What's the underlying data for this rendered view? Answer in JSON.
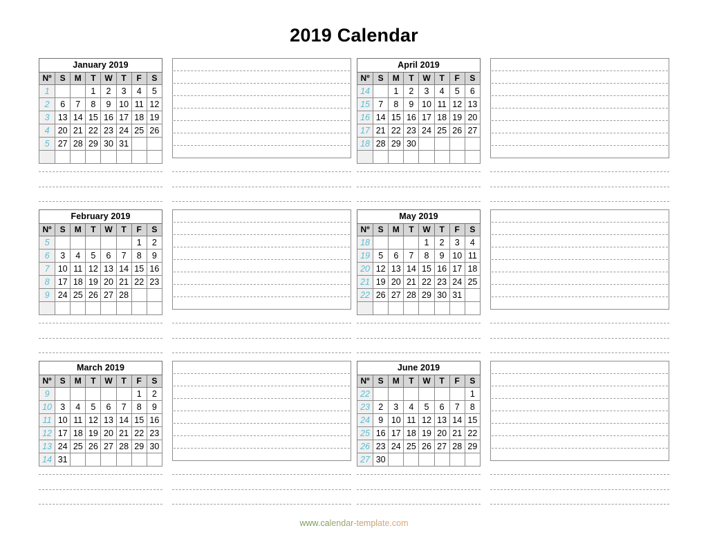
{
  "page": {
    "title": "2019 Calendar",
    "footer_url": "www.calendar-template.com",
    "footer_parts": [
      "www.ca",
      "lendar",
      "-templ",
      "ate.com"
    ]
  },
  "colors": {
    "week_number": "#5bbcd6",
    "header_row_bg": "#d6d6d6",
    "week_col_bg": "#f0f0f0",
    "table_border": "#8a8a8a",
    "dashed_line": "#9a9a9a",
    "footer_green": "#7ba05b",
    "footer_orange": "#d8a878"
  },
  "labels": {
    "week_col_header": "Nº",
    "day_headers": [
      "S",
      "M",
      "T",
      "W",
      "T",
      "F",
      "S"
    ]
  },
  "months": [
    {
      "name": "January 2019",
      "weeks": [
        {
          "no": "1",
          "days": [
            "",
            "",
            "1",
            "2",
            "3",
            "4",
            "5"
          ]
        },
        {
          "no": "2",
          "days": [
            "6",
            "7",
            "8",
            "9",
            "10",
            "11",
            "12"
          ]
        },
        {
          "no": "3",
          "days": [
            "13",
            "14",
            "15",
            "16",
            "17",
            "18",
            "19"
          ]
        },
        {
          "no": "4",
          "days": [
            "20",
            "21",
            "22",
            "23",
            "24",
            "25",
            "26"
          ]
        },
        {
          "no": "5",
          "days": [
            "27",
            "28",
            "29",
            "30",
            "31",
            "",
            ""
          ]
        },
        {
          "no": "",
          "days": [
            "",
            "",
            "",
            "",
            "",
            "",
            ""
          ]
        }
      ]
    },
    {
      "name": "February 2019",
      "weeks": [
        {
          "no": "5",
          "days": [
            "",
            "",
            "",
            "",
            "",
            "1",
            "2"
          ]
        },
        {
          "no": "6",
          "days": [
            "3",
            "4",
            "5",
            "6",
            "7",
            "8",
            "9"
          ]
        },
        {
          "no": "7",
          "days": [
            "10",
            "11",
            "12",
            "13",
            "14",
            "15",
            "16"
          ]
        },
        {
          "no": "8",
          "days": [
            "17",
            "18",
            "19",
            "20",
            "21",
            "22",
            "23"
          ]
        },
        {
          "no": "9",
          "days": [
            "24",
            "25",
            "26",
            "27",
            "28",
            "",
            ""
          ]
        },
        {
          "no": "",
          "days": [
            "",
            "",
            "",
            "",
            "",
            "",
            ""
          ]
        }
      ]
    },
    {
      "name": "March 2019",
      "weeks": [
        {
          "no": "9",
          "days": [
            "",
            "",
            "",
            "",
            "",
            "1",
            "2"
          ]
        },
        {
          "no": "10",
          "days": [
            "3",
            "4",
            "5",
            "6",
            "7",
            "8",
            "9"
          ]
        },
        {
          "no": "11",
          "days": [
            "10",
            "11",
            "12",
            "13",
            "14",
            "15",
            "16"
          ]
        },
        {
          "no": "12",
          "days": [
            "17",
            "18",
            "19",
            "20",
            "21",
            "22",
            "23"
          ]
        },
        {
          "no": "13",
          "days": [
            "24",
            "25",
            "26",
            "27",
            "28",
            "29",
            "30"
          ]
        },
        {
          "no": "14",
          "days": [
            "31",
            "",
            "",
            "",
            "",
            "",
            ""
          ]
        }
      ]
    },
    {
      "name": "April 2019",
      "weeks": [
        {
          "no": "14",
          "days": [
            "",
            "1",
            "2",
            "3",
            "4",
            "5",
            "6"
          ]
        },
        {
          "no": "15",
          "days": [
            "7",
            "8",
            "9",
            "10",
            "11",
            "12",
            "13"
          ]
        },
        {
          "no": "16",
          "days": [
            "14",
            "15",
            "16",
            "17",
            "18",
            "19",
            "20"
          ]
        },
        {
          "no": "17",
          "days": [
            "21",
            "22",
            "23",
            "24",
            "25",
            "26",
            "27"
          ]
        },
        {
          "no": "18",
          "days": [
            "28",
            "29",
            "30",
            "",
            "",
            "",
            ""
          ]
        },
        {
          "no": "",
          "days": [
            "",
            "",
            "",
            "",
            "",
            "",
            ""
          ]
        }
      ]
    },
    {
      "name": "May 2019",
      "weeks": [
        {
          "no": "18",
          "days": [
            "",
            "",
            "",
            "1",
            "2",
            "3",
            "4"
          ]
        },
        {
          "no": "19",
          "days": [
            "5",
            "6",
            "7",
            "8",
            "9",
            "10",
            "11"
          ]
        },
        {
          "no": "20",
          "days": [
            "12",
            "13",
            "14",
            "15",
            "16",
            "17",
            "18"
          ]
        },
        {
          "no": "21",
          "days": [
            "19",
            "20",
            "21",
            "22",
            "23",
            "24",
            "25"
          ]
        },
        {
          "no": "22",
          "days": [
            "26",
            "27",
            "28",
            "29",
            "30",
            "31",
            ""
          ]
        },
        {
          "no": "",
          "days": [
            "",
            "",
            "",
            "",
            "",
            "",
            ""
          ]
        }
      ]
    },
    {
      "name": "June 2019",
      "weeks": [
        {
          "no": "22",
          "days": [
            "",
            "",
            "",
            "",
            "",
            "",
            "1"
          ]
        },
        {
          "no": "23",
          "days": [
            "2",
            "3",
            "4",
            "5",
            "6",
            "7",
            "8"
          ]
        },
        {
          "no": "24",
          "days": [
            "9",
            "10",
            "11",
            "12",
            "13",
            "14",
            "15"
          ]
        },
        {
          "no": "25",
          "days": [
            "16",
            "17",
            "18",
            "19",
            "20",
            "21",
            "22"
          ]
        },
        {
          "no": "26",
          "days": [
            "23",
            "24",
            "25",
            "26",
            "27",
            "28",
            "29"
          ]
        },
        {
          "no": "27",
          "days": [
            "30",
            "",
            "",
            "",
            "",
            "",
            ""
          ]
        }
      ]
    }
  ],
  "notes": {
    "lines_per_box": 8,
    "separator_lines_per_gap": 3,
    "boxes": [
      {
        "id": "notes-january",
        "lines": [
          "",
          "",
          "",
          "",
          "",
          "",
          "",
          ""
        ]
      },
      {
        "id": "notes-january-right",
        "lines": [
          "",
          "",
          "",
          "",
          "",
          "",
          "",
          ""
        ]
      },
      {
        "id": "notes-april",
        "lines": [
          "",
          "",
          "",
          "",
          "",
          "",
          "",
          ""
        ]
      },
      {
        "id": "notes-april-right",
        "lines": [
          "",
          "",
          "",
          "",
          "",
          "",
          "",
          ""
        ]
      },
      {
        "id": "notes-february",
        "lines": [
          "",
          "",
          "",
          "",
          "",
          "",
          "",
          ""
        ]
      },
      {
        "id": "notes-february-right",
        "lines": [
          "",
          "",
          "",
          "",
          "",
          "",
          "",
          ""
        ]
      },
      {
        "id": "notes-may",
        "lines": [
          "",
          "",
          "",
          "",
          "",
          "",
          "",
          ""
        ]
      },
      {
        "id": "notes-may-right",
        "lines": [
          "",
          "",
          "",
          "",
          "",
          "",
          "",
          ""
        ]
      },
      {
        "id": "notes-march",
        "lines": [
          "",
          "",
          "",
          "",
          "",
          "",
          "",
          ""
        ]
      },
      {
        "id": "notes-march-right",
        "lines": [
          "",
          "",
          "",
          "",
          "",
          "",
          "",
          ""
        ]
      },
      {
        "id": "notes-june",
        "lines": [
          "",
          "",
          "",
          "",
          "",
          "",
          "",
          ""
        ]
      },
      {
        "id": "notes-june-right",
        "lines": [
          "",
          "",
          "",
          "",
          "",
          "",
          "",
          ""
        ]
      }
    ]
  }
}
